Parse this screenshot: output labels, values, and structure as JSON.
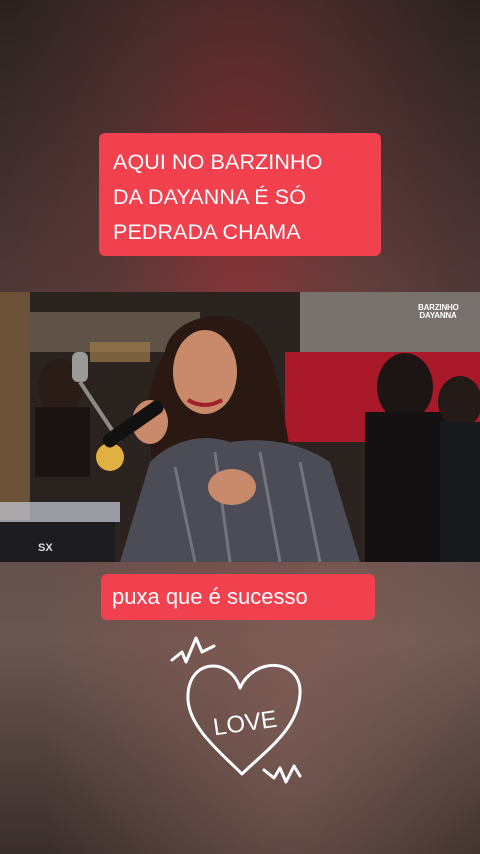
{
  "captions": {
    "top": "AQUI NO BARZINHO\nDA DAYANNA É SÓ\nPEDRADA CHAMA",
    "bottom": "puxa que é sucesso"
  },
  "video": {
    "watermark_line1": "BARZINHO",
    "watermark_line2": "DAYANNA",
    "keyboard_brand": "SX"
  },
  "sticker": {
    "text": "LOVE"
  },
  "colors": {
    "caption_bg": "#f1414f",
    "caption_text": "#ffffff"
  }
}
